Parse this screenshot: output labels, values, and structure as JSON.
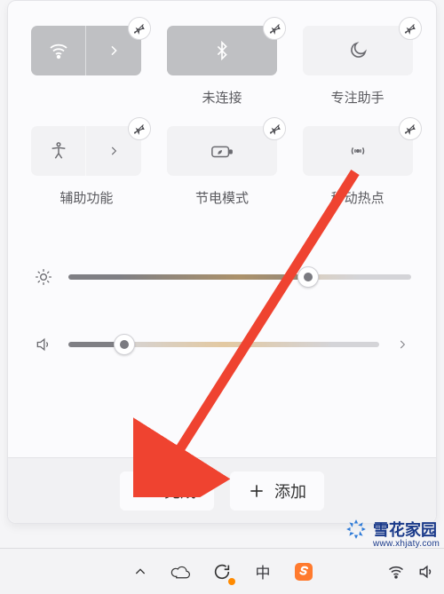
{
  "tiles": [
    {
      "id": "wifi",
      "label": "",
      "active": true,
      "split": true,
      "blurLabel": true
    },
    {
      "id": "bluetooth",
      "label": "未连接",
      "active": true,
      "split": false
    },
    {
      "id": "focus-assist",
      "label": "专注助手",
      "active": false,
      "split": false
    },
    {
      "id": "accessibility",
      "label": "辅助功能",
      "active": false,
      "split": true
    },
    {
      "id": "battery-saver",
      "label": "节电模式",
      "active": false,
      "split": false
    },
    {
      "id": "hotspot",
      "label": "移动热点",
      "active": false,
      "split": false
    }
  ],
  "sliders": {
    "brightness": {
      "percent": 70
    },
    "volume": {
      "percent": 18
    }
  },
  "footer": {
    "done_label": "完成",
    "add_label": "添加"
  },
  "taskbar": {
    "ime_label": "中"
  },
  "watermark": {
    "brand": "雪花家园",
    "url": "www.xhjaty.com"
  }
}
